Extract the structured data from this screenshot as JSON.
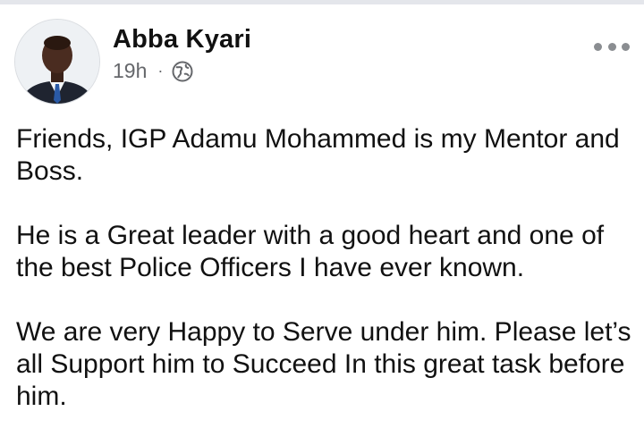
{
  "post": {
    "author": "Abba Kyari",
    "time": "19h",
    "separator": "·",
    "audience_icon": "globe-icon",
    "more_icon": "more-options-icon",
    "paragraphs": [
      "Friends, IGP Adamu Mohammed is my Mentor and Boss.",
      "He is a Great leader with a good heart and one of the best Police Officers I have ever known.",
      "We are very Happy to Serve under him. Please let’s all Support him to Succeed In this great task before him."
    ]
  },
  "colors": {
    "text": "#111111",
    "meta": "#65676b",
    "icon": "#8a8d91",
    "divider": "#e4e6eb"
  }
}
